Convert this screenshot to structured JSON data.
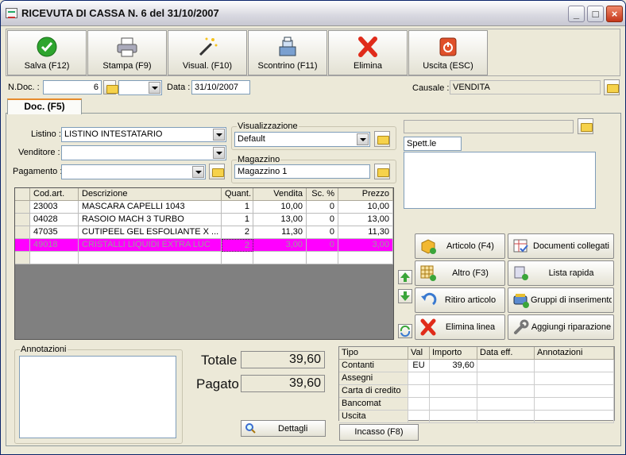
{
  "window": {
    "title": "RICEVUTA DI CASSA N. 6  del 31/10/2007",
    "min_label": "_",
    "max_label": "□",
    "close_label": "×"
  },
  "toolbar": {
    "save_label": "Salva (F12)",
    "print_label": "Stampa (F9)",
    "preview_label": "Visual. (F10)",
    "receipt_label": "Scontrino (F11)",
    "delete_label": "Elimina",
    "exit_label": "Uscita (ESC)"
  },
  "header": {
    "ndoc_label": "N.Doc. :",
    "ndoc_value": "6",
    "data_label": "Data :",
    "data_value": "31/10/2007",
    "causale_label": "Causale :",
    "causale_value": "VENDITA"
  },
  "tab": {
    "label": "Doc. (F5)"
  },
  "form": {
    "listino_label": "Listino :",
    "listino_value": "LISTINO INTESTATARIO",
    "venditore_label": "Venditore :",
    "venditore_value": "",
    "pagamento_label": "Pagamento :",
    "pagamento_value": "",
    "visualizzazione_label": "Visualizzazione",
    "visualizzazione_value": "Default",
    "magazzino_label": "Magazzino",
    "magazzino_value": "Magazzino 1",
    "client_field": "",
    "spett_value": "Spett.le"
  },
  "grid": {
    "headers": [
      "Cod.art.",
      "Descrizione",
      "Quant.",
      "Vendita",
      "Sc. %",
      "Prezzo"
    ],
    "rows": [
      [
        "23003",
        "MASCARA CAPELLI 1043",
        "1",
        "10,00",
        "0",
        "10,00"
      ],
      [
        "04028",
        "RASOIO MACH 3 TURBO",
        "1",
        "13,00",
        "0",
        "13,00"
      ],
      [
        "47035",
        "CUTIPEEL GEL ESFOLIANTE X ...",
        "2",
        "11,30",
        "0",
        "11,30"
      ],
      [
        "49018",
        "CRISTALLI LIQUIDI EXTRA LUC",
        "2",
        "3,00",
        "0",
        "3,00"
      ]
    ]
  },
  "side_buttons": {
    "articolo": "Articolo (F4)",
    "documenti": "Documenti collegati",
    "altro": "Altro (F3)",
    "lista": "Lista rapida",
    "ritiro": "Ritiro articolo",
    "gruppi": "Gruppi di inserimento",
    "elimina_linea": "Elimina linea",
    "riparazione": "Aggiungi riparazione"
  },
  "notes": {
    "label": "Annotazioni"
  },
  "totals": {
    "totale_label": "Totale",
    "totale_value": "39,60",
    "pagato_label": "Pagato",
    "pagato_value": "39,60",
    "dettagli_label": "Dettagli"
  },
  "payments": {
    "headers": [
      "Tipo",
      "Val",
      "Importo",
      "Data eff.",
      "Annotazioni"
    ],
    "rows": [
      [
        "Contanti",
        "EU",
        "39,60",
        "",
        ""
      ],
      [
        "Assegni",
        "",
        "",
        "",
        ""
      ],
      [
        "Carta di credito",
        "",
        "",
        "",
        ""
      ],
      [
        "Bancomat",
        "",
        "",
        "",
        ""
      ],
      [
        "Uscita",
        "",
        "",
        "",
        ""
      ]
    ],
    "incasso_label": "Incasso (F8)"
  },
  "colors": {
    "selected_row": "#ff00ff",
    "accent_tab": "#e68b2c",
    "delete_red": "#e02b1a",
    "save_green": "#2ea52e"
  }
}
